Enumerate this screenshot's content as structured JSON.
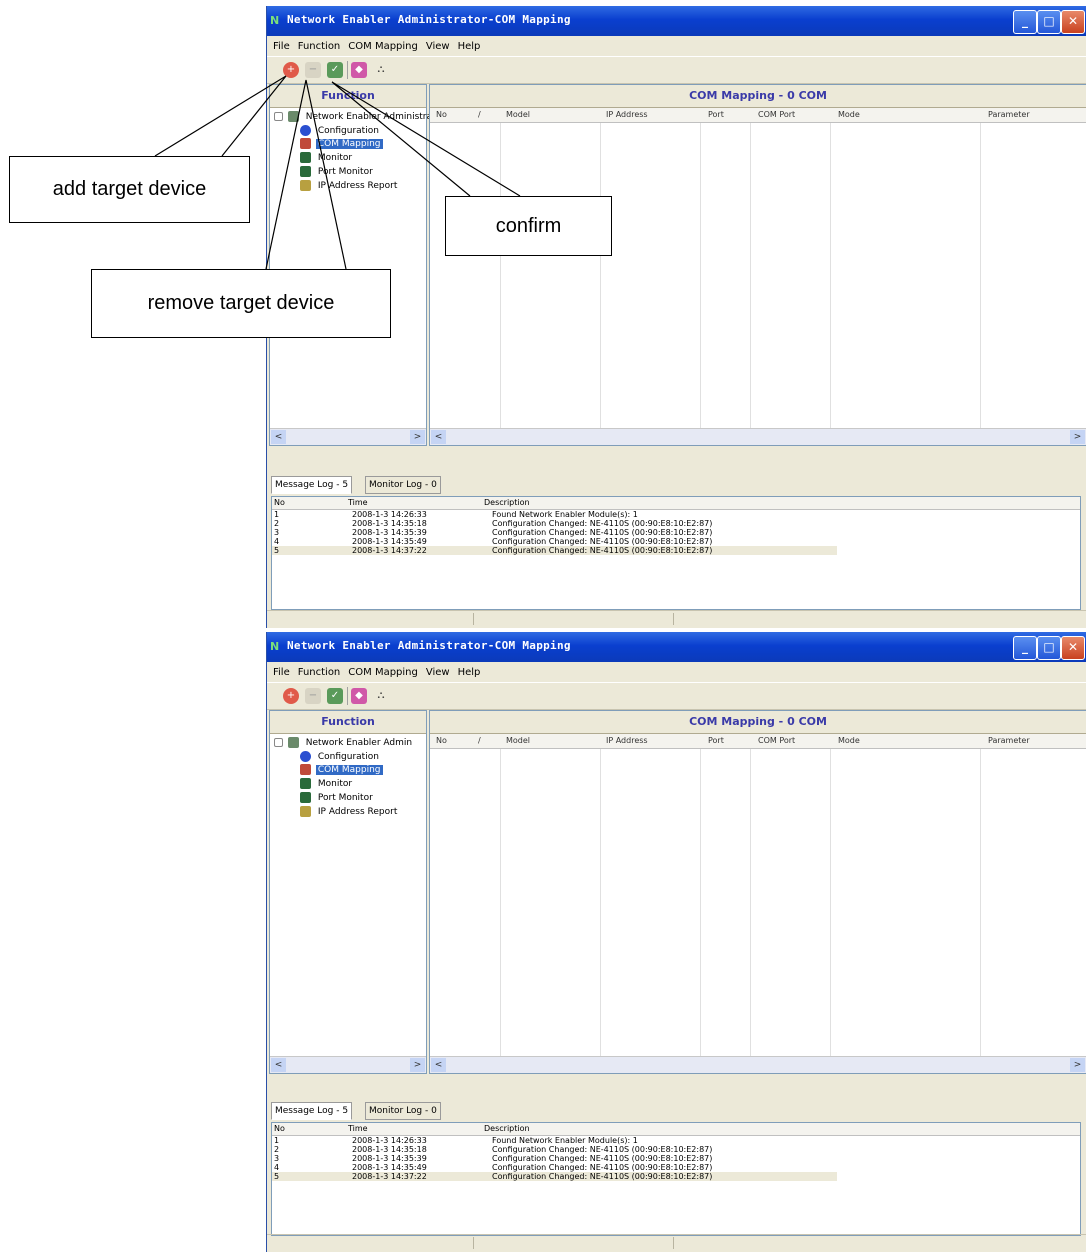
{
  "window": {
    "title": "Network Enabler Administrator-COM Mapping",
    "minimize_glyph": "_",
    "maximize_glyph": "□",
    "close_glyph": "✕"
  },
  "menu": [
    "File",
    "Function",
    "COM Mapping",
    "View",
    "Help"
  ],
  "toolbar_icons": [
    "add-target-icon",
    "remove-target-icon",
    "confirm-icon",
    "search-icon",
    "exit-icon"
  ],
  "function_panel": {
    "header": "Function",
    "top_window_root": "Network Enabler Administrator",
    "root": "Network Enabler Admin",
    "items": [
      "Configuration",
      "COM Mapping",
      "Monitor",
      "Port Monitor",
      "IP Address Report"
    ]
  },
  "com_mapping": {
    "header": "COM Mapping - 0 COM",
    "columns": [
      "No",
      "Model",
      "IP Address",
      "Port",
      "COM Port",
      "Mode",
      "Parameter"
    ],
    "sort_indicator": "/"
  },
  "log_tabs": [
    "Message Log - 5",
    "Monitor Log - 0"
  ],
  "log": {
    "columns": [
      "No",
      "Time",
      "Description"
    ],
    "rows": [
      {
        "no": "1",
        "time": "2008-1-3 14:26:33",
        "desc": "Found Network Enabler Module(s): 1"
      },
      {
        "no": "2",
        "time": "2008-1-3 14:35:18",
        "desc": "Configuration Changed: NE-4110S (00:90:E8:10:E2:87)"
      },
      {
        "no": "3",
        "time": "2008-1-3 14:35:39",
        "desc": "Configuration Changed: NE-4110S (00:90:E8:10:E2:87)"
      },
      {
        "no": "4",
        "time": "2008-1-3 14:35:49",
        "desc": "Configuration Changed: NE-4110S (00:90:E8:10:E2:87)"
      },
      {
        "no": "5",
        "time": "2008-1-3 14:37:22",
        "desc": "Configuration Changed: NE-4110S (00:90:E8:10:E2:87)"
      }
    ]
  },
  "callouts": {
    "add": "add target device",
    "remove": "remove target device",
    "confirm": "confirm"
  },
  "scroll": {
    "left": "<",
    "right": ">"
  }
}
